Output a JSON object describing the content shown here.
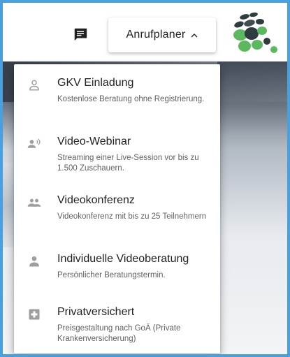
{
  "header": {
    "chat_icon": "chat-bubble-icon",
    "anrufplaner_label": "Anrufplaner",
    "anrufplaner_caret": "chevron-up-icon",
    "logo": "brand-logo"
  },
  "menu": {
    "items": [
      {
        "icon": "person-outline-icon",
        "title": "GKV Einladung",
        "description": "Kostenlose Beratung ohne Registrierung."
      },
      {
        "icon": "person-broadcast-icon",
        "title": "Video-Webinar",
        "description": "Streaming einer Live-Session vor bis zu 1.500 Zuschauern."
      },
      {
        "icon": "people-group-icon",
        "title": "Videokonferenz",
        "description": "Videokonferenz mit bis zu 25 Teilnehmern"
      },
      {
        "icon": "person-filled-icon",
        "title": "Individuelle Videoberatung",
        "description": "Persönlicher Beratungstermin."
      },
      {
        "icon": "medical-plus-icon",
        "title": "Privatversichert",
        "description": "Preisgestaltung nach GoÄ (Private Krankenversicherung)"
      }
    ]
  },
  "colors": {
    "frame_border": "#4aa0de",
    "icon_gray": "#9e9e9e",
    "logo_green": "#5cb85c",
    "logo_dark": "#2e3b3f"
  }
}
